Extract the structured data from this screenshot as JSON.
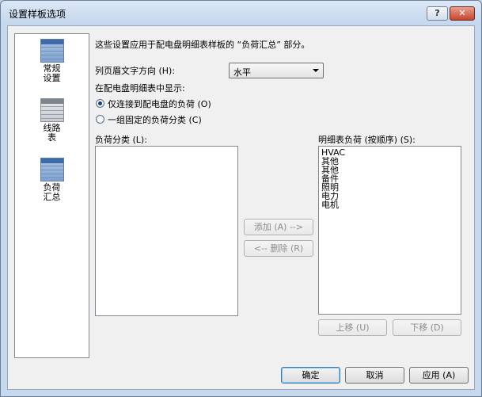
{
  "window": {
    "title": "设置样板选项",
    "help_label": "?",
    "close_label": "✕"
  },
  "nav": {
    "items": [
      {
        "label": "常规\n设置",
        "icon": "blue-grid-icon"
      },
      {
        "label": "线路\n表",
        "icon": "gray-grid-icon"
      },
      {
        "label": "负荷\n汇总",
        "icon": "blue-grid-icon"
      }
    ]
  },
  "content": {
    "description": "这些设置应用于配电盘明细表样板的 “负荷汇总” 部分。",
    "header_direction_label": "列页眉文字方向 (H):",
    "header_direction_value": "水平",
    "show_in_schedule_label": "在配电盘明细表中显示:",
    "radio_connected": "仅连接到配电盘的负荷 (O)",
    "radio_fixed": "一组固定的负荷分类 (C)",
    "load_class_label": "负荷分类 (L):",
    "schedule_loads_label": "明细表负荷 (按顺序) (S):",
    "schedule_loads": [
      "HVAC",
      "其他",
      "其他",
      "备件",
      "照明",
      "电力",
      "电机"
    ],
    "add_button": "添加 (A) -->",
    "remove_button": "<-- 删除 (R)",
    "move_up_button": "上移 (U)",
    "move_down_button": "下移 (D)"
  },
  "footer": {
    "ok": "确定",
    "cancel": "取消",
    "apply": "应用 (A)"
  }
}
